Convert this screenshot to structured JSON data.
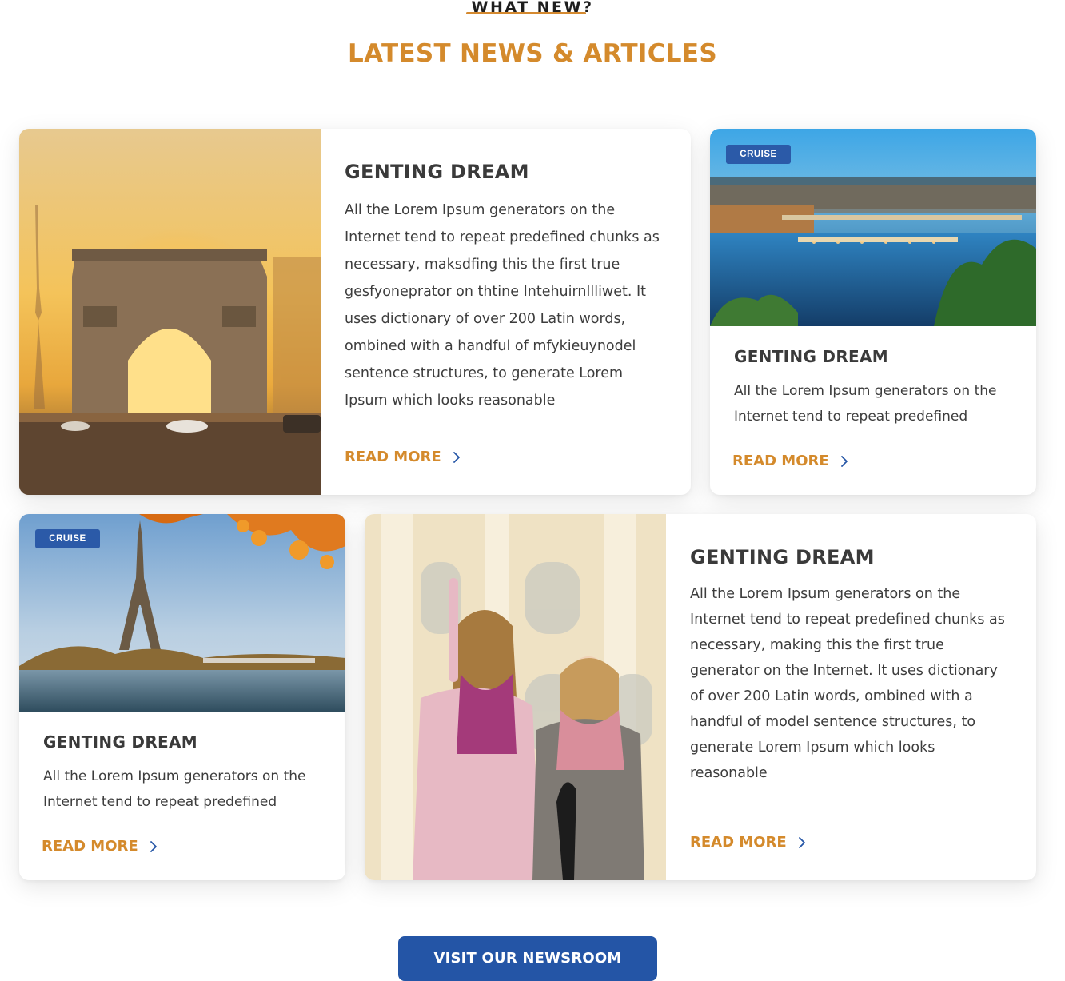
{
  "section": {
    "eyebrow": "WHAT NEW?",
    "heading": "LATEST NEWS & ARTICLES"
  },
  "articles": [
    {
      "title": "GENTING DREAM",
      "body": "All the Lorem Ipsum generators on the Internet tend to repeat predefined chunks as necessary, maksdfing this the first true gesfyoneprator on thtine Intehuirnllliwet. It uses dictionary of over 200 Latin words, ombined with a handful of mfykieuynodel sentence structures, to generate Lorem Ipsum which looks reasonable",
      "read_more": "READ MORE",
      "image": "arc-de-triomphe-sunset"
    },
    {
      "badge": "CRUISE",
      "title": "GENTING DREAM",
      "body": "All the Lorem Ipsum generators on the Internet tend to repeat predefined",
      "read_more": "READ MORE",
      "image": "river-city-bridges-dusk"
    },
    {
      "badge": "CRUISE",
      "title": "GENTING DREAM",
      "body": "All the Lorem Ipsum generators on the Internet tend to repeat predefined",
      "read_more": "READ MORE",
      "image": "eiffel-tower-seine-autumn"
    },
    {
      "title": "GENTING DREAM",
      "body": "All the Lorem Ipsum generators on the Internet tend to repeat predefined chunks as necessary, making this the first true generator on the Internet. It uses dictionary of over 200 Latin words, ombined with a handful of model sentence structures, to generate Lorem Ipsum which looks reasonable",
      "read_more": "READ MORE",
      "image": "two-women-sightseeing"
    }
  ],
  "cta": {
    "label": "VISIT OUR NEWSROOM"
  },
  "colors": {
    "accent": "#d48a2c",
    "primary": "#2455a6",
    "badge": "#2b5aa8"
  }
}
